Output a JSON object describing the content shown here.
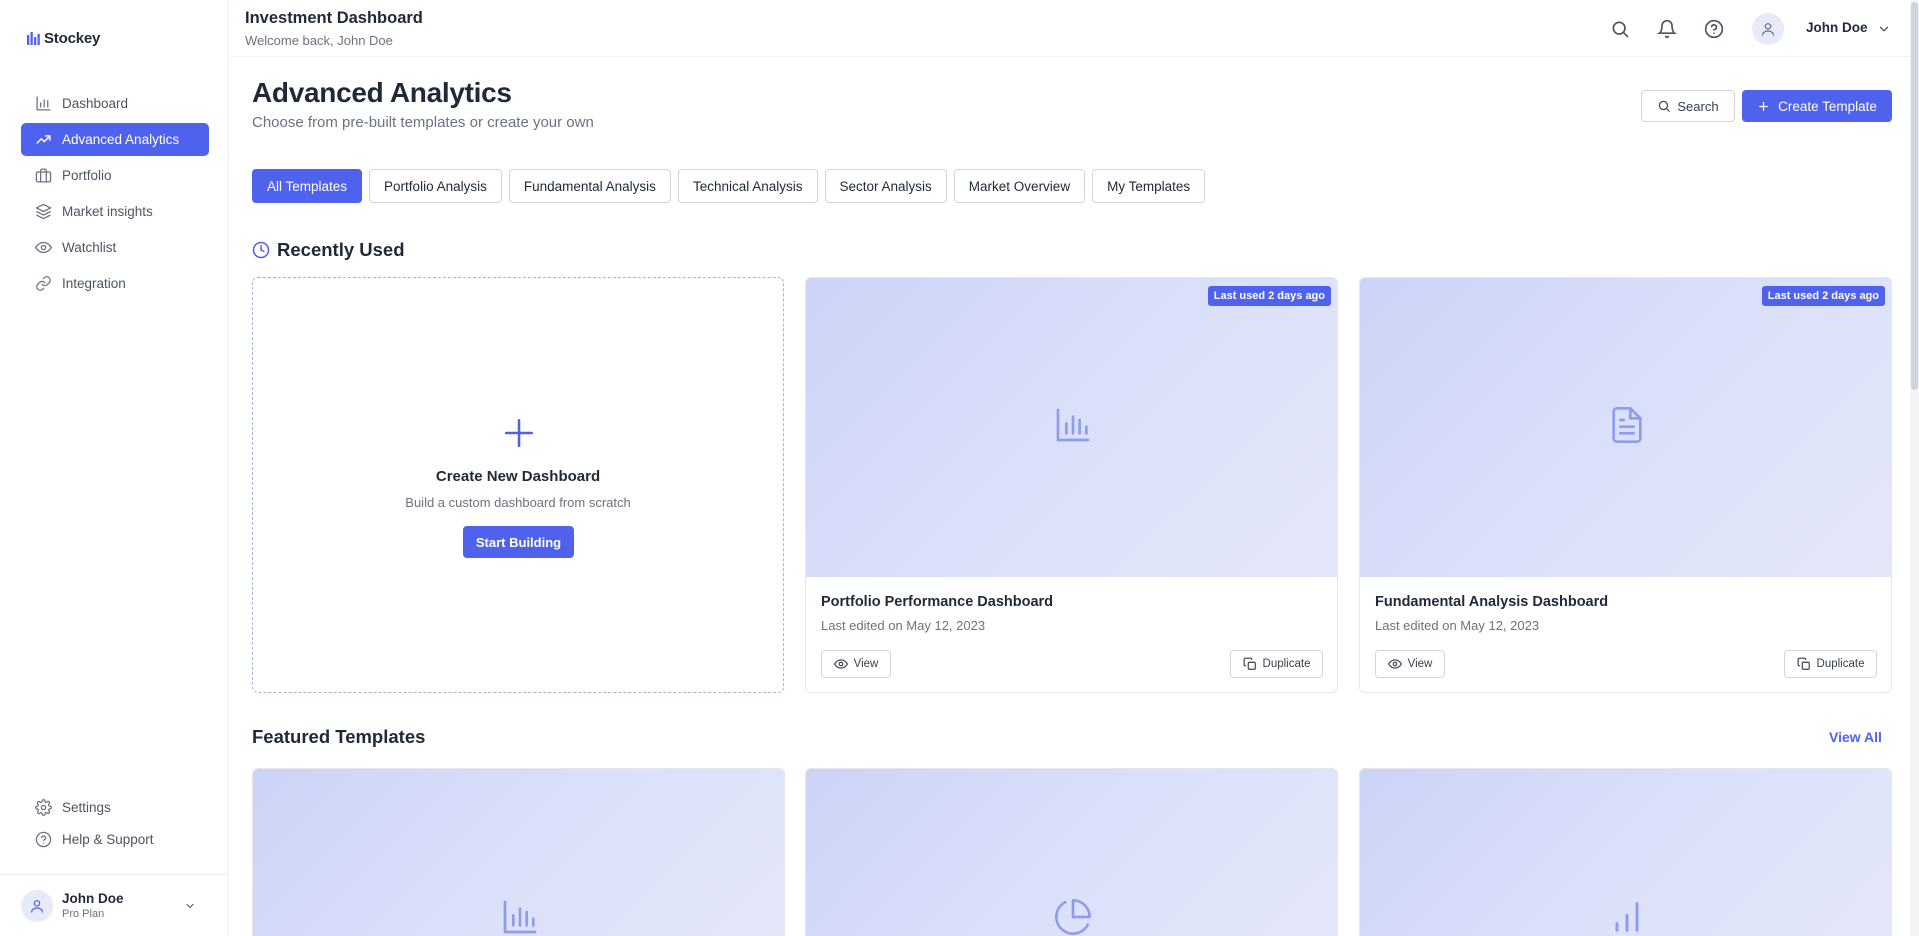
{
  "app": {
    "name": "Stockey"
  },
  "sidebar": {
    "items": [
      {
        "label": "Dashboard",
        "icon": "bar-chart-icon"
      },
      {
        "label": "Advanced Analytics",
        "icon": "trending-up-icon",
        "active": true
      },
      {
        "label": "Portfolio",
        "icon": "briefcase-icon"
      },
      {
        "label": "Market insights",
        "icon": "layers-icon"
      },
      {
        "label": "Watchlist",
        "icon": "eye-icon"
      },
      {
        "label": "Integration",
        "icon": "link-icon"
      }
    ],
    "bottom_items": [
      {
        "label": "Settings",
        "icon": "gear-icon"
      },
      {
        "label": "Help & Support",
        "icon": "help-circle-icon"
      }
    ],
    "user": {
      "name": "John Doe",
      "plan": "Pro Plan"
    }
  },
  "header": {
    "title": "Investment Dashboard",
    "subtitle": "Welcome back, John Doe",
    "user_name": "John Doe"
  },
  "main": {
    "title": "Advanced Analytics",
    "subtitle": "Choose from pre-built templates or create your own",
    "search_label": "Search",
    "create_label": "Create Template",
    "tabs": [
      {
        "label": "All Templates",
        "active": true
      },
      {
        "label": "Portfolio Analysis"
      },
      {
        "label": "Fundamental Analysis"
      },
      {
        "label": "Technical Analysis"
      },
      {
        "label": "Sector Analysis"
      },
      {
        "label": "Market Overview"
      },
      {
        "label": "My Templates"
      }
    ],
    "recent": {
      "title": "Recently Used",
      "create_card": {
        "title": "Create New Dashboard",
        "subtitle": "Build a custom dashboard from scratch",
        "button": "Start Building"
      },
      "cards": [
        {
          "title": "Portfolio Performance Dashboard",
          "meta": "Last edited on May 12, 2023",
          "badge": "Last used 2 days ago",
          "icon": "bar-chart-icon",
          "view": "View",
          "duplicate": "Duplicate"
        },
        {
          "title": "Fundamental Analysis Dashboard",
          "meta": "Last edited on May 12, 2023",
          "badge": "Last used 2 days ago",
          "icon": "document-icon",
          "view": "View",
          "duplicate": "Duplicate"
        }
      ]
    },
    "featured": {
      "title": "Featured Templates",
      "view_all": "View All",
      "cards": [
        {
          "icon": "bar-chart-icon"
        },
        {
          "icon": "pie-chart-icon"
        },
        {
          "icon": "signal-bars-icon"
        }
      ]
    }
  },
  "colors": {
    "accent": "#4f62ee",
    "thumb_icon": "#8f9ceb",
    "text": "#1f2937",
    "muted": "#6b7280"
  }
}
